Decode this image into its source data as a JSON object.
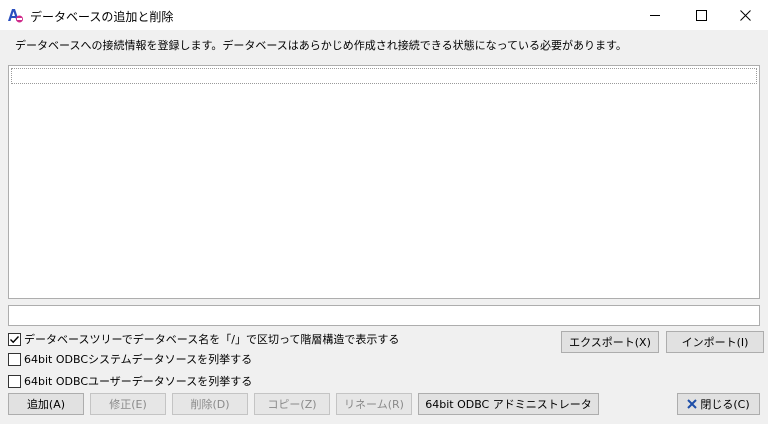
{
  "window": {
    "title": "データベースの追加と削除",
    "min_icon": "minimize-icon",
    "max_icon": "maximize-icon",
    "close_icon": "close-icon"
  },
  "description": "データベースへの接続情報を登録します。データベースはあらかじめ作成され接続できる状態になっている必要があります。",
  "path_field": {
    "value": ""
  },
  "options": {
    "tree_view": {
      "label": "データベースツリーでデータベース名を「/」で区切って階層構造で表示する",
      "checked": true
    },
    "system_dsn": {
      "label": "64bit ODBCシステムデータソースを列挙する",
      "checked": false
    },
    "user_dsn": {
      "label": "64bit ODBCユーザーデータソースを列挙する",
      "checked": false
    }
  },
  "buttons": {
    "export": "エクスポート(X)",
    "import": "インポート(I)",
    "add": "追加(A)",
    "edit": "修正(E)",
    "delete": "削除(D)",
    "copy": "コピー(Z)",
    "rename": "リネーム(R)",
    "odbc_admin": "64bit ODBC アドミニストレータ",
    "close": "閉じる(C)"
  },
  "colors": {
    "disabled_text": "#8a8a8a",
    "button_face": "#e1e1e1",
    "border": "#adadad"
  }
}
